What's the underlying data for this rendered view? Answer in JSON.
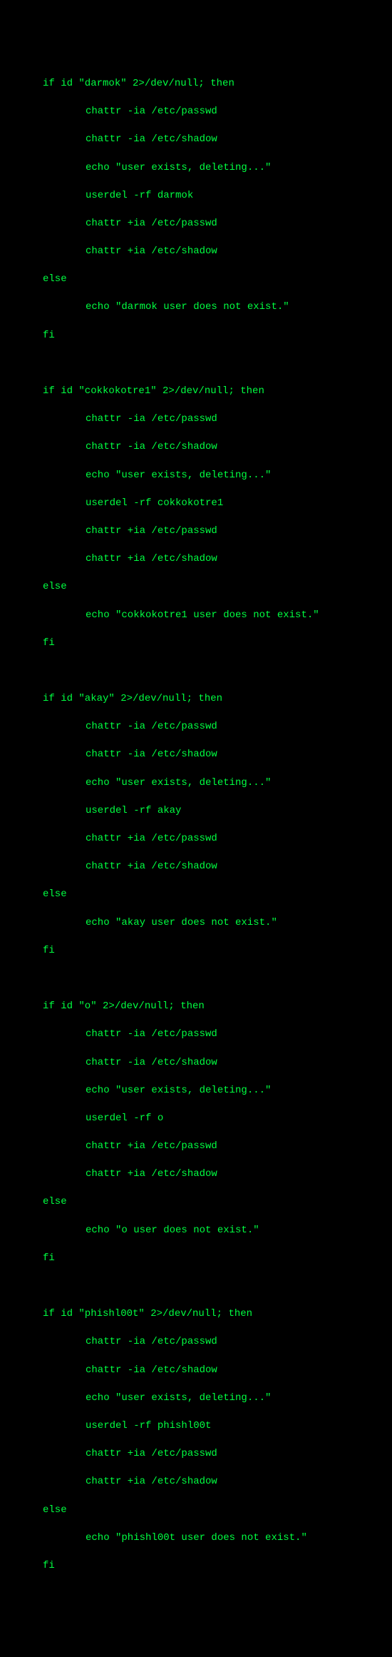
{
  "users": [
    {
      "name": "darmok",
      "if_line": "if id \"darmok\" 2>/dev/null; then",
      "chattr_minus_passwd": "chattr -ia /etc/passwd",
      "chattr_minus_shadow": "chattr -ia /etc/shadow",
      "echo_deleting": "echo \"user exists, deleting...\"",
      "userdel": "userdel -rf darmok",
      "chattr_plus_passwd": "chattr +ia /etc/passwd",
      "chattr_plus_shadow": "chattr +ia /etc/shadow",
      "else_line": "else",
      "echo_not_exist": "echo \"darmok user does not exist.\"",
      "fi_line": "fi"
    },
    {
      "name": "cokkokotre1",
      "if_line": "if id \"cokkokotre1\" 2>/dev/null; then",
      "chattr_minus_passwd": "chattr -ia /etc/passwd",
      "chattr_minus_shadow": "chattr -ia /etc/shadow",
      "echo_deleting": "echo \"user exists, deleting...\"",
      "userdel": "userdel -rf cokkokotre1",
      "chattr_plus_passwd": "chattr +ia /etc/passwd",
      "chattr_plus_shadow": "chattr +ia /etc/shadow",
      "else_line": "else",
      "echo_not_exist": "echo \"cokkokotre1 user does not exist.\"",
      "fi_line": "fi"
    },
    {
      "name": "akay",
      "if_line": "if id \"akay\" 2>/dev/null; then",
      "chattr_minus_passwd": "chattr -ia /etc/passwd",
      "chattr_minus_shadow": "chattr -ia /etc/shadow",
      "echo_deleting": "echo \"user exists, deleting...\"",
      "userdel": "userdel -rf akay",
      "chattr_plus_passwd": "chattr +ia /etc/passwd",
      "chattr_plus_shadow": "chattr +ia /etc/shadow",
      "else_line": "else",
      "echo_not_exist": "echo \"akay user does not exist.\"",
      "fi_line": "fi"
    },
    {
      "name": "o",
      "if_line": "if id \"o\" 2>/dev/null; then",
      "chattr_minus_passwd": "chattr -ia /etc/passwd",
      "chattr_minus_shadow": "chattr -ia /etc/shadow",
      "echo_deleting": "echo \"user exists, deleting...\"",
      "userdel": "userdel -rf o",
      "chattr_plus_passwd": "chattr +ia /etc/passwd",
      "chattr_plus_shadow": "chattr +ia /etc/shadow",
      "else_line": "else",
      "echo_not_exist": "echo \"o user does not exist.\"",
      "fi_line": "fi"
    },
    {
      "name": "phishl00t",
      "if_line": "if id \"phishl00t\" 2>/dev/null; then",
      "chattr_minus_passwd": "chattr -ia /etc/passwd",
      "chattr_minus_shadow": "chattr -ia /etc/shadow",
      "echo_deleting": "echo \"user exists, deleting...\"",
      "userdel": "userdel -rf phishl00t",
      "chattr_plus_passwd": "chattr +ia /etc/passwd",
      "chattr_plus_shadow": "chattr +ia /etc/shadow",
      "else_line": "else",
      "echo_not_exist": "echo \"phishl00t user does not exist.\"",
      "fi_line": "fi"
    }
  ]
}
